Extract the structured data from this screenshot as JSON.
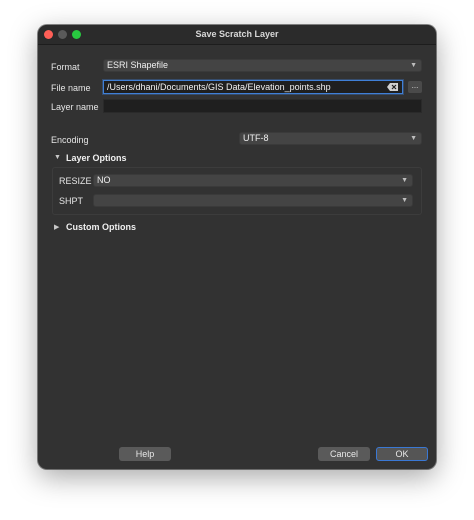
{
  "window": {
    "title": "Save Scratch Layer"
  },
  "form": {
    "format_label": "Format",
    "format_value": "ESRI Shapefile",
    "filename_label": "File name",
    "filename_value": "/Users/dhani/Documents/GIS Data/Elevation_points.shp",
    "browse_label": "...",
    "layername_label": "Layer name",
    "layername_value": "",
    "encoding_label": "Encoding",
    "encoding_value": "UTF-8"
  },
  "layer_options": {
    "title": "Layer Options",
    "expanded": true,
    "resize_label": "RESIZE",
    "resize_value": "NO",
    "shpt_label": "SHPT",
    "shpt_value": ""
  },
  "custom_options": {
    "title": "Custom Options",
    "expanded": false
  },
  "buttons": {
    "help": "Help",
    "cancel": "Cancel",
    "ok": "OK"
  },
  "colors": {
    "window_bg": "#323232",
    "accent": "#3a78d4",
    "close": "#ff5f57",
    "maximize": "#28c840"
  }
}
